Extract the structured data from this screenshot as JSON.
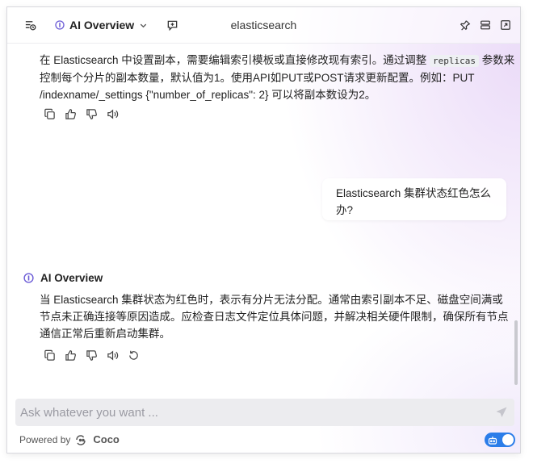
{
  "header": {
    "mode_label": "AI Overview",
    "title": "elasticsearch"
  },
  "messages": {
    "answer1": {
      "before_code": "在 Elasticsearch 中设置副本，需要编辑索引模板或直接修改现有索引。通过调整 ",
      "code": "replicas",
      "after_code": " 参数来",
      "line2": "控制每个分片的副本数量，默认值为1。使用API如PUT或POST请求更新配置。例如：PUT",
      "line3": "/indexname/_settings {\"number_of_replicas\": 2} 可以将副本数设为2。"
    },
    "question": {
      "line1": "Elasticsearch 集群状态红色怎么",
      "line2": "办?"
    },
    "answer2": {
      "heading": "AI Overview",
      "line1": "当 Elasticsearch 集群状态为红色时，表示有分片无法分配。通常由索引副本不足、磁盘空间满或",
      "line2": "节点未正确连接等原因造成。应检查日志文件定位具体问题，并解决相关硬件限制，确保所有节点",
      "line3": "通信正常后重新启动集群。"
    }
  },
  "input": {
    "placeholder": "Ask whatever you want ..."
  },
  "footer": {
    "powered_by": "Powered by",
    "brand": "Coco"
  },
  "colors": {
    "accent": "#2b7de9",
    "ai_icon": "#6b5bd6"
  },
  "icons": [
    "history-icon",
    "ai-overview-icon",
    "chevron-down-icon",
    "new-chat-icon",
    "pin-icon",
    "window-icon",
    "external-window-icon",
    "copy-icon",
    "thumbs-up-icon",
    "thumbs-down-icon",
    "speaker-icon",
    "retry-icon",
    "send-icon",
    "coco-logo-icon",
    "robot-icon"
  ]
}
